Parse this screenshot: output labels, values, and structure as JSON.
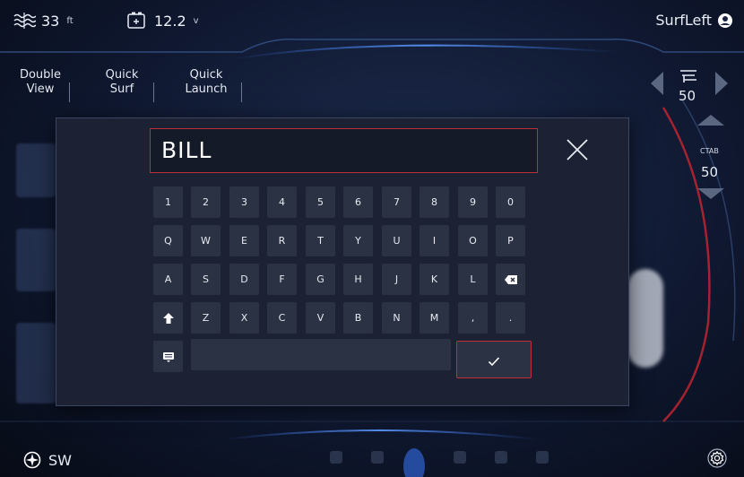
{
  "status": {
    "depth_value": "33",
    "depth_unit": "ft",
    "depth_icon": "depth-waves-icon",
    "battery_value": "12.2",
    "battery_unit": "v",
    "battery_icon": "battery-icon"
  },
  "profile": {
    "name": "SurfLeft",
    "icon": "user-circle-icon"
  },
  "tabs": [
    {
      "line1": "Double",
      "line2": "View"
    },
    {
      "line1": "Quick",
      "line2": "Surf"
    },
    {
      "line1": "Quick",
      "line2": "Launch"
    }
  ],
  "right_panel": {
    "trim_value": "50",
    "trim_icon": "trim-tab-icon",
    "ctab_label": "CTAB",
    "ctab_value": "50"
  },
  "keyboard": {
    "input_value": "BILL",
    "rows": [
      [
        "1",
        "2",
        "3",
        "4",
        "5",
        "6",
        "7",
        "8",
        "9",
        "0"
      ],
      [
        "Q",
        "W",
        "E",
        "R",
        "T",
        "Y",
        "U",
        "I",
        "O",
        "P"
      ],
      [
        "A",
        "S",
        "D",
        "F",
        "G",
        "H",
        "J",
        "K",
        "L"
      ],
      [
        "Z",
        "X",
        "C",
        "V",
        "B",
        "N",
        "M",
        ",",
        "."
      ]
    ],
    "backspace_icon": "backspace-icon",
    "shift_icon": "shift-arrow-icon",
    "layout_icon": "keyboard-icon",
    "confirm_icon": "checkmark-icon",
    "close_icon": "close-icon"
  },
  "bottom": {
    "heading": "SW",
    "compass_icon": "compass-icon",
    "settings_icon": "gear-icon"
  },
  "colors": {
    "accent_red": "#c0303a",
    "key_bg": "#2b3244",
    "dialog_bg": "#1c2233",
    "glow_blue": "#3a78ff"
  }
}
